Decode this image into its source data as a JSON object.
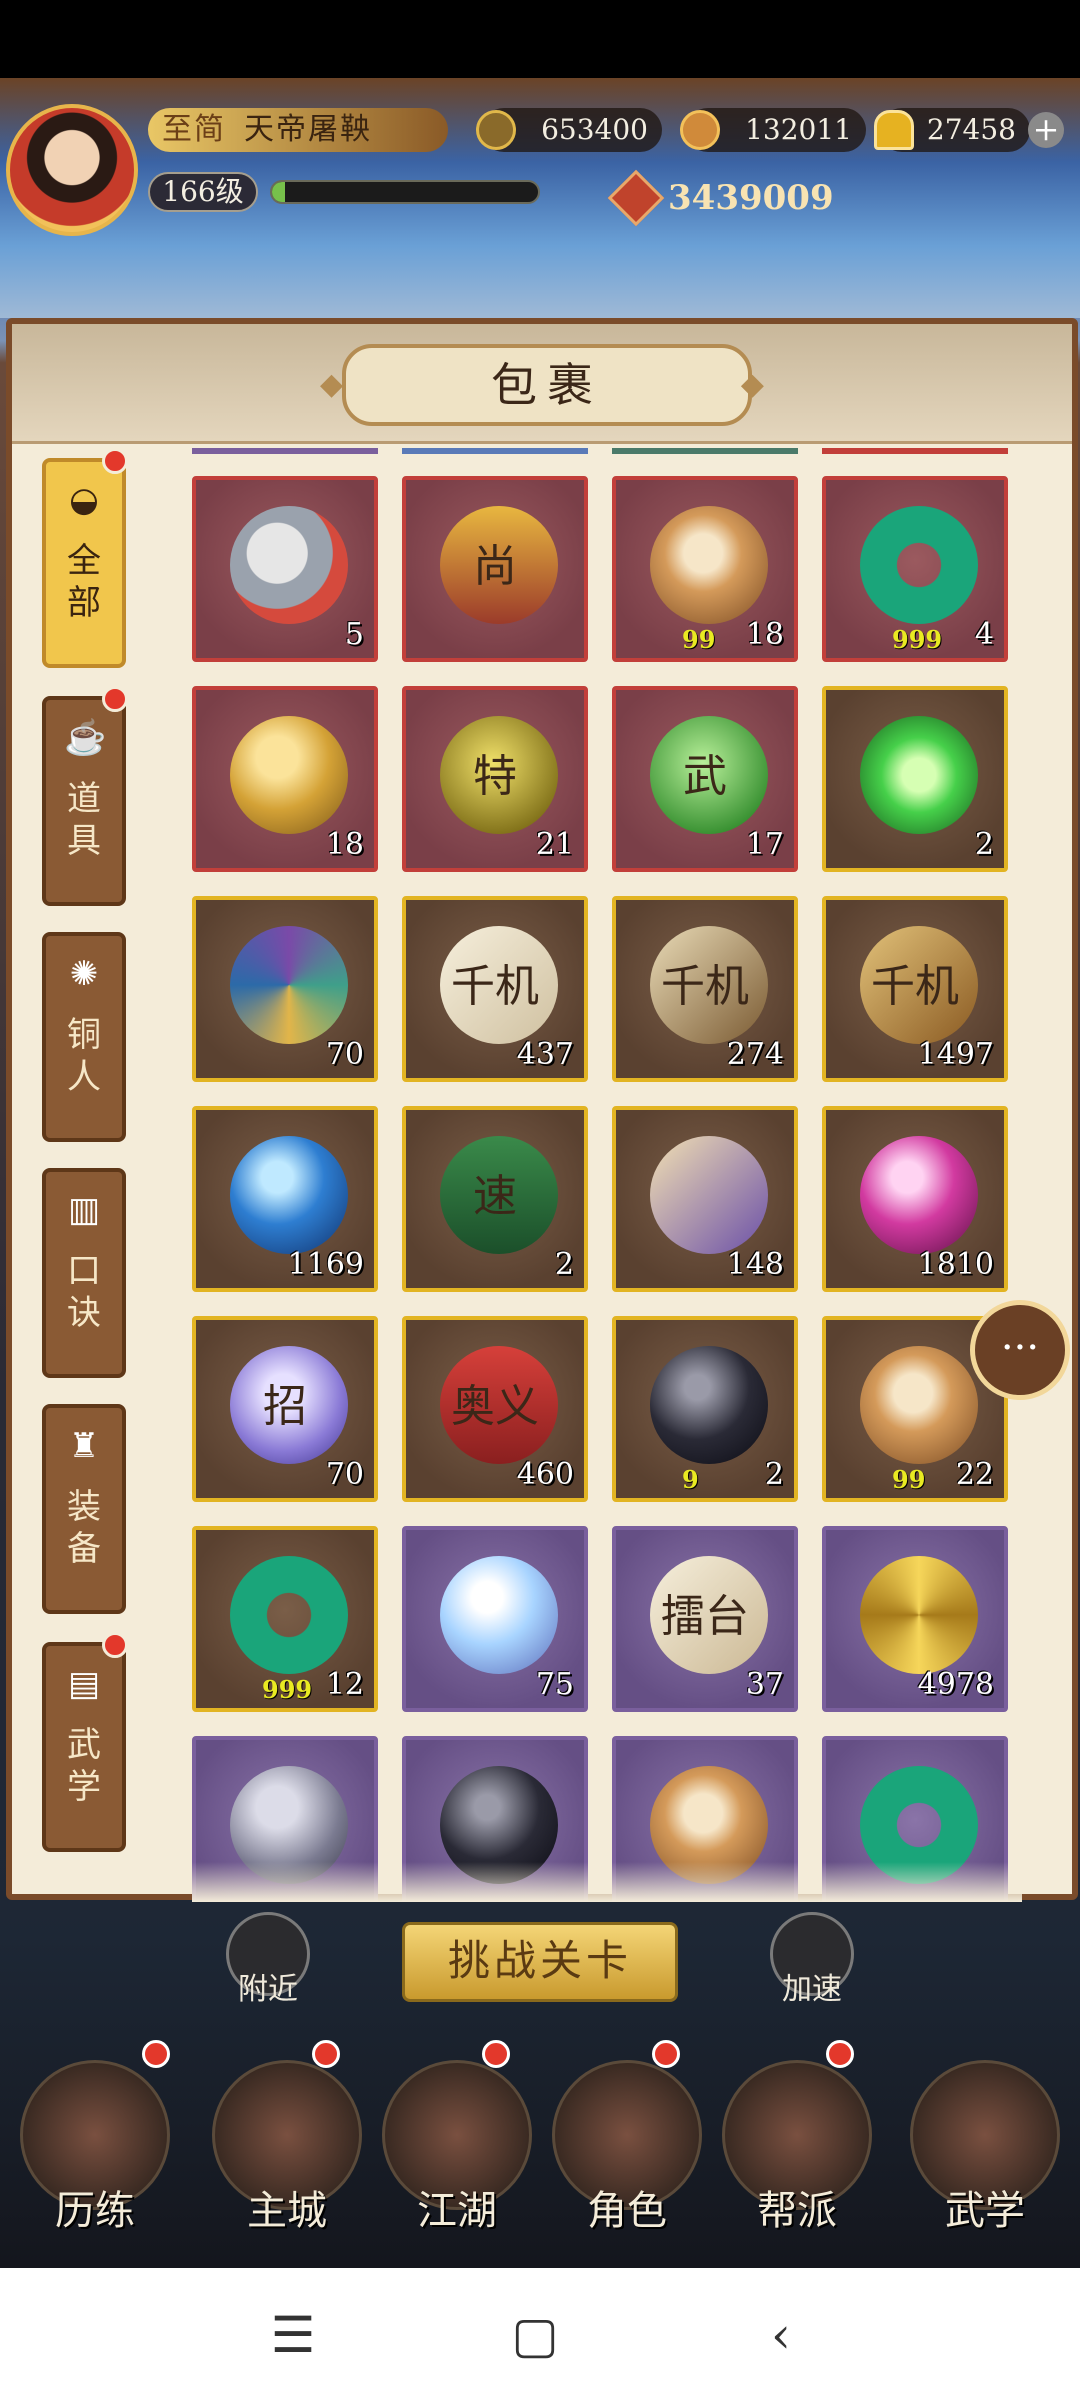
{
  "hud": {
    "name_prefix": "至简",
    "player_name": "天帝屠鞅",
    "level": "166级",
    "coins": "653400",
    "jade": "132011",
    "gold": "27458",
    "power": "3439009",
    "exp_fraction": 0.05
  },
  "panel": {
    "title": "包裹"
  },
  "tabs": [
    {
      "icon": "fan-icon",
      "label": "全部",
      "active": true,
      "dot": true
    },
    {
      "icon": "teapot-icon",
      "label": "道具",
      "active": false,
      "dot": true
    },
    {
      "icon": "figure-icon",
      "label": "铜人",
      "active": false,
      "dot": false
    },
    {
      "icon": "scroll-icon",
      "label": "口诀",
      "active": false,
      "dot": false
    },
    {
      "icon": "armor-icon",
      "label": "装备",
      "active": false,
      "dot": false
    },
    {
      "icon": "book-icon",
      "label": "武学",
      "active": false,
      "dot": true
    }
  ],
  "items": [
    {
      "icon": "rouge-box-icon",
      "quality": "red",
      "qty": "5",
      "sub": ""
    },
    {
      "icon": "token-plaque-icon",
      "quality": "red",
      "qty": "",
      "sub": "",
      "glyph": "尚"
    },
    {
      "icon": "amber-stone-icon",
      "quality": "red",
      "qty": "18",
      "sub": "99"
    },
    {
      "icon": "jade-ring-icon",
      "quality": "red",
      "qty": "4",
      "sub": "999"
    },
    {
      "icon": "gold-nugget-icon",
      "quality": "red",
      "qty": "18",
      "sub": ""
    },
    {
      "icon": "special-gem-icon",
      "quality": "red",
      "qty": "21",
      "sub": "",
      "glyph": "特"
    },
    {
      "icon": "martial-gem-icon",
      "quality": "red",
      "qty": "17",
      "sub": "",
      "glyph": "武"
    },
    {
      "icon": "refresh-orb-icon",
      "quality": "gold",
      "qty": "2",
      "sub": ""
    },
    {
      "icon": "flower-icon",
      "quality": "gold",
      "qty": "70",
      "sub": ""
    },
    {
      "icon": "qianji-scroll-icon",
      "quality": "gold",
      "qty": "437",
      "sub": "",
      "glyph": "千机"
    },
    {
      "icon": "qianji-book-icon",
      "quality": "gold",
      "qty": "274",
      "sub": "",
      "glyph": "千机"
    },
    {
      "icon": "qianji-bundle-icon",
      "quality": "gold",
      "qty": "1497",
      "sub": "",
      "glyph": "千机"
    },
    {
      "icon": "blue-orb-icon",
      "quality": "gold",
      "qty": "1169",
      "sub": ""
    },
    {
      "icon": "speed-tag-icon",
      "quality": "gold",
      "qty": "2",
      "sub": "",
      "glyph": "速"
    },
    {
      "icon": "rolled-scroll-icon",
      "quality": "gold",
      "qty": "148",
      "sub": ""
    },
    {
      "icon": "pink-orb-icon",
      "quality": "gold",
      "qty": "1810",
      "sub": ""
    },
    {
      "icon": "move-orb-icon",
      "quality": "gold",
      "qty": "70",
      "sub": "",
      "glyph": "招"
    },
    {
      "icon": "banner-scroll-icon",
      "quality": "gold",
      "qty": "460",
      "sub": "",
      "glyph": "奥义"
    },
    {
      "icon": "black-stone-icon",
      "quality": "gold",
      "qty": "2",
      "sub": "9"
    },
    {
      "icon": "amber-stone-icon",
      "quality": "gold",
      "qty": "22",
      "sub": "99"
    },
    {
      "icon": "jade-ring-icon",
      "quality": "gold",
      "qty": "12",
      "sub": "999"
    },
    {
      "icon": "crystal-icon",
      "quality": "purple",
      "qty": "75",
      "sub": ""
    },
    {
      "icon": "arena-paper-icon",
      "quality": "purple",
      "qty": "37",
      "sub": "",
      "glyph": "擂台"
    },
    {
      "icon": "gold-star-icon",
      "quality": "purple",
      "qty": "4978",
      "sub": ""
    },
    {
      "icon": "ore-icon",
      "quality": "purple",
      "qty": "",
      "sub": ""
    },
    {
      "icon": "black-stone-icon",
      "quality": "purple",
      "qty": "",
      "sub": ""
    },
    {
      "icon": "amber-stone-icon",
      "quality": "purple",
      "qty": "",
      "sub": ""
    },
    {
      "icon": "jade-ring-icon",
      "quality": "purple",
      "qty": "",
      "sub": ""
    }
  ],
  "buttons": {
    "nearby": "附近",
    "challenge": "挑战关卡",
    "speed_up": "加速"
  },
  "nav": [
    {
      "label": "历练",
      "dot": true
    },
    {
      "label": "主城",
      "dot": true
    },
    {
      "label": "江湖",
      "dot": true
    },
    {
      "label": "角色",
      "dot": true
    },
    {
      "label": "帮派",
      "dot": true
    },
    {
      "label": "武学",
      "dot": false
    }
  ],
  "colors": {
    "red_quality": "#c23f3a",
    "gold_quality": "#e2b422",
    "purple_quality": "#7a5f9d"
  }
}
